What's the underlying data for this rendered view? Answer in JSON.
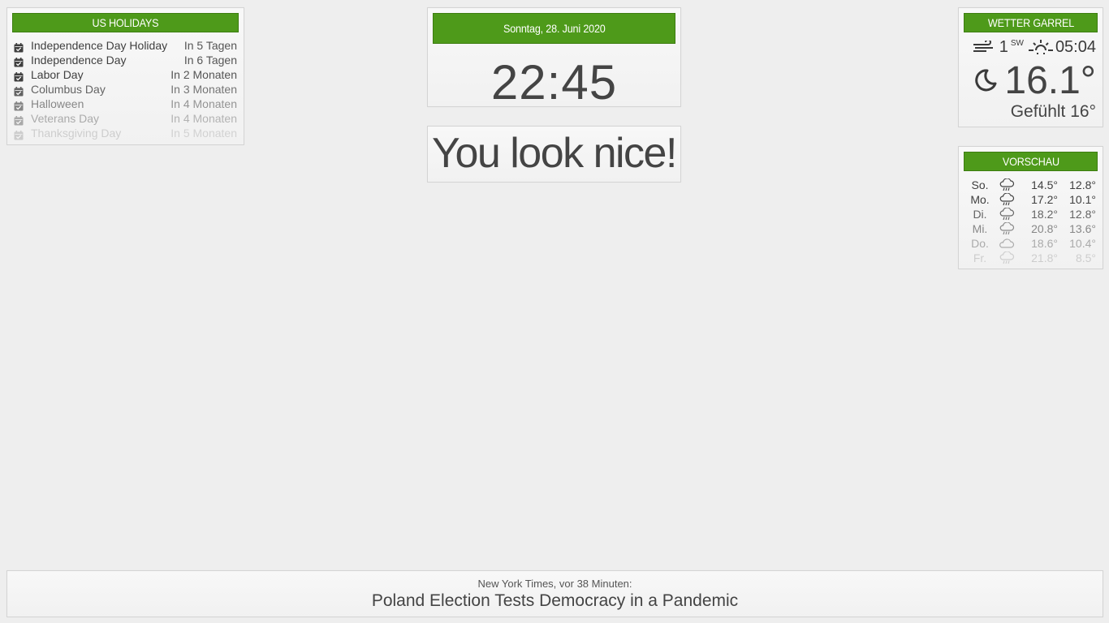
{
  "holidays": {
    "title": "US HOLIDAYS",
    "items": [
      {
        "name": "Independence Day Holiday",
        "when": "In 5 Tagen",
        "opacity": 1.0
      },
      {
        "name": "Independence Day",
        "when": "In 6 Tagen",
        "opacity": 1.0
      },
      {
        "name": "Labor Day",
        "when": "In 2 Monaten",
        "opacity": 1.0
      },
      {
        "name": "Columbus Day",
        "when": "In 3 Monaten",
        "opacity": 0.8
      },
      {
        "name": "Halloween",
        "when": "In 4 Monaten",
        "opacity": 0.6
      },
      {
        "name": "Veterans Day",
        "when": "In 4 Monaten",
        "opacity": 0.4
      },
      {
        "name": "Thanksgiving Day",
        "when": "In 5 Monaten",
        "opacity": 0.2
      }
    ]
  },
  "clock": {
    "date": "Sonntag, 28. Juni 2020",
    "time": "22:45"
  },
  "compliment": {
    "text": "You look nice!"
  },
  "weather": {
    "title": "WETTER GARREL",
    "wind_icon": "wind-icon",
    "wind_speed": "1",
    "wind_dir": "SW",
    "sunrise_icon": "sunrise-icon",
    "sunrise_time": "05:04",
    "condition_icon": "moon-icon",
    "temperature": "16.1°",
    "feels_like": "Gefühlt 16°"
  },
  "forecast": {
    "title": "VORSCHAU",
    "days": [
      {
        "day": "So.",
        "icon": "rain-icon",
        "hi": "14.5°",
        "lo": "12.8°",
        "opacity": 1.0
      },
      {
        "day": "Mo.",
        "icon": "rain-icon",
        "hi": "17.2°",
        "lo": "10.1°",
        "opacity": 1.0
      },
      {
        "day": "Di.",
        "icon": "rain-icon",
        "hi": "18.2°",
        "lo": "12.8°",
        "opacity": 0.8
      },
      {
        "day": "Mi.",
        "icon": "rain-icon",
        "hi": "20.8°",
        "lo": "13.6°",
        "opacity": 0.6
      },
      {
        "day": "Do.",
        "icon": "cloudy-icon",
        "hi": "18.6°",
        "lo": "10.4°",
        "opacity": 0.4
      },
      {
        "day": "Fr.",
        "icon": "rain-icon",
        "hi": "21.8°",
        "lo": "8.5°",
        "opacity": 0.2
      }
    ]
  },
  "news": {
    "source": "New York Times, vor 38 Minuten:",
    "headline": "Poland Election Tests Democracy in a Pandemic"
  },
  "colors": {
    "accent": "#4e9a1a",
    "background": "#eeeeee",
    "text": "#3f3f3f"
  }
}
